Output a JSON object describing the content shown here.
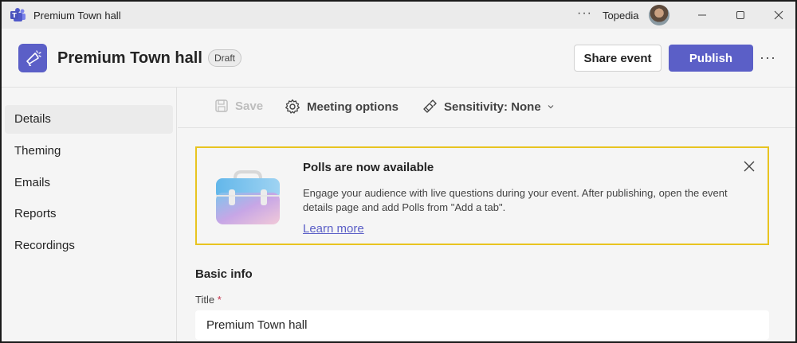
{
  "window": {
    "title": "Premium Town hall",
    "more_label": "···",
    "org_name": "Topedia"
  },
  "header": {
    "event_title": "Premium Town hall",
    "status_badge": "Draft",
    "share_label": "Share event",
    "publish_label": "Publish",
    "more_label": "···"
  },
  "nav": {
    "items": [
      {
        "label": "Details"
      },
      {
        "label": "Theming"
      },
      {
        "label": "Emails"
      },
      {
        "label": "Reports"
      },
      {
        "label": "Recordings"
      }
    ]
  },
  "toolbar": {
    "save_label": "Save",
    "meeting_options_label": "Meeting options",
    "sensitivity_label": "Sensitivity: None"
  },
  "banner": {
    "title": "Polls are now available",
    "body": "Engage your audience with live questions during your event. After publishing, open the event details page and add Polls from \"Add a tab\".",
    "link": "Learn more"
  },
  "basic_info": {
    "section_title": "Basic info",
    "title_label": "Title",
    "required_mark": "*",
    "title_value": "Premium Town hall"
  },
  "colors": {
    "accent": "#5b5fc7",
    "banner_border": "#e8c420",
    "required": "#c4314b"
  }
}
